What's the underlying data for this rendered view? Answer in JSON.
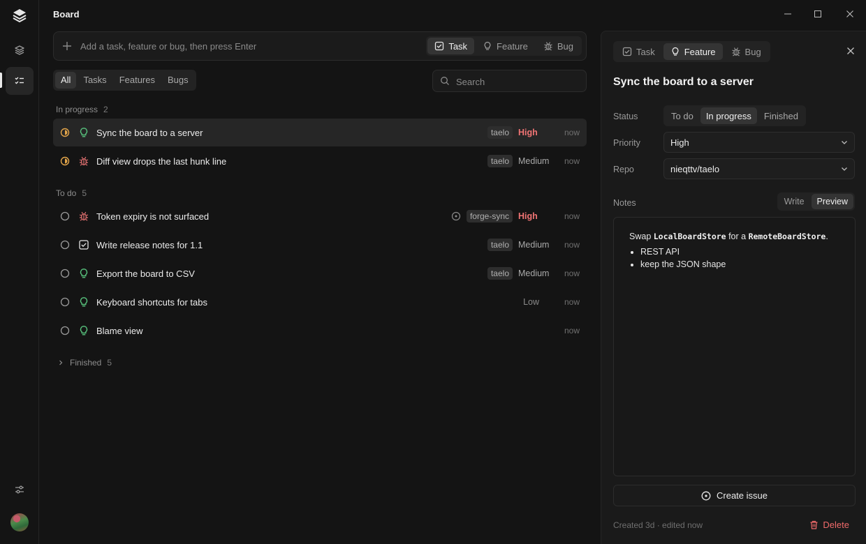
{
  "app": {
    "title": "Board"
  },
  "composer": {
    "placeholder": "Add a task, feature or bug, then press Enter",
    "types": [
      {
        "label": "Task",
        "active": true
      },
      {
        "label": "Feature",
        "active": false
      },
      {
        "label": "Bug",
        "active": false
      }
    ]
  },
  "filters": {
    "tabs": [
      "All",
      "Tasks",
      "Features",
      "Bugs"
    ],
    "active": "All",
    "search_placeholder": "Search"
  },
  "sections": {
    "in_progress": {
      "label": "In progress",
      "count": "2",
      "items": [
        {
          "kind": "feature",
          "title": "Sync the board to a server",
          "repo": "taelo",
          "priority": "High",
          "time": "now",
          "selected": true
        },
        {
          "kind": "bug",
          "title": "Diff view drops the last hunk line",
          "repo": "taelo",
          "priority": "Medium",
          "time": "now"
        }
      ]
    },
    "todo": {
      "label": "To do",
      "count": "5",
      "items": [
        {
          "kind": "bug",
          "title": "Token expiry is not surfaced",
          "repo": "forge-sync",
          "priority": "High",
          "time": "now",
          "linked": true
        },
        {
          "kind": "task",
          "title": "Write release notes for 1.1",
          "repo": "taelo",
          "priority": "Medium",
          "time": "now"
        },
        {
          "kind": "feature",
          "title": "Export the board to CSV",
          "repo": "taelo",
          "priority": "Medium",
          "time": "now"
        },
        {
          "kind": "feature",
          "title": "Keyboard shortcuts for tabs",
          "repo": "",
          "priority": "Low",
          "time": "now"
        },
        {
          "kind": "feature",
          "title": "Blame view",
          "repo": "",
          "priority": "",
          "time": "now"
        }
      ]
    },
    "finished": {
      "label": "Finished",
      "count": "5"
    }
  },
  "detail": {
    "kinds": [
      {
        "label": "Task",
        "active": false
      },
      {
        "label": "Feature",
        "active": true
      },
      {
        "label": "Bug",
        "active": false
      }
    ],
    "title": "Sync the board to a server",
    "status_label": "Status",
    "status_options": [
      "To do",
      "In progress",
      "Finished"
    ],
    "status_active": "In progress",
    "priority_label": "Priority",
    "priority_value": "High",
    "repo_label": "Repo",
    "repo_value": "nieqttv/taelo",
    "notes_label": "Notes",
    "notes_modes": [
      "Write",
      "Preview"
    ],
    "notes_mode_active": "Preview",
    "notes": {
      "line_prefix": "Swap ",
      "code_a": "LocalBoardStore",
      "line_mid": " for a ",
      "code_b": "RemoteBoardStore",
      "line_suffix": ".",
      "bullets": [
        "REST API",
        "keep the JSON shape"
      ]
    },
    "create_issue_label": "Create issue",
    "meta": "Created 3d · edited now",
    "delete_label": "Delete"
  },
  "colors": {
    "accent_high": "#f07474",
    "in_progress": "#e3a54a",
    "feature_icon": "#58c27d",
    "bug_icon": "#e07070",
    "delete": "#f06a6a"
  },
  "icons": {
    "sidebar": [
      "logo-stack-icon",
      "layers-icon",
      "checklist-icon",
      "sliders-icon",
      "avatar"
    ],
    "window": [
      "minimize-icon",
      "maximize-icon",
      "close-icon"
    ]
  }
}
